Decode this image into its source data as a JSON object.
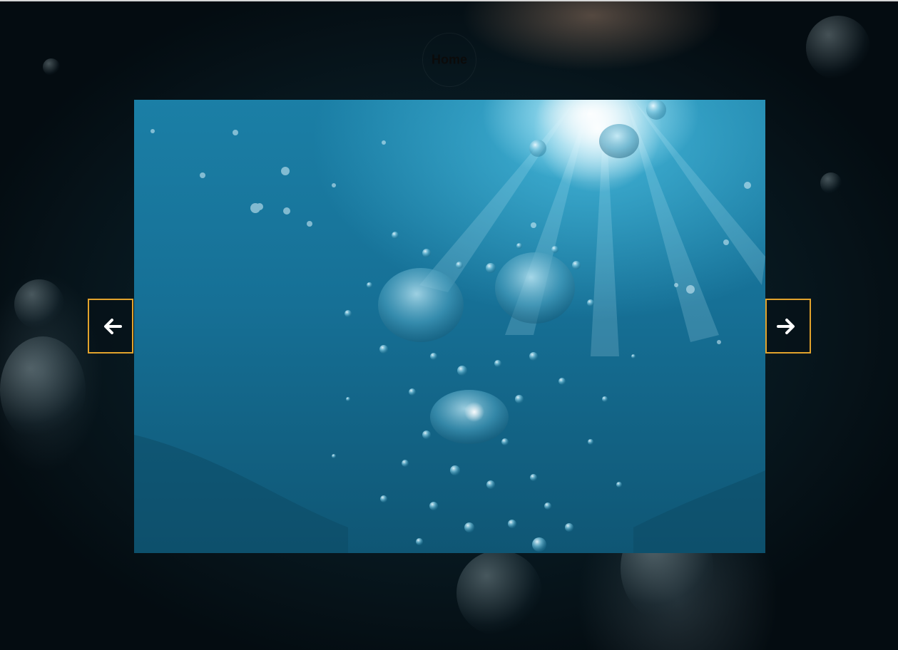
{
  "header": {
    "home_label": "Home"
  },
  "carousel": {
    "prev_icon": "arrow-left-icon",
    "next_icon": "arrow-right-icon",
    "accent_color": "#e2a32c",
    "image_subject": "underwater-bubbles-photo"
  }
}
